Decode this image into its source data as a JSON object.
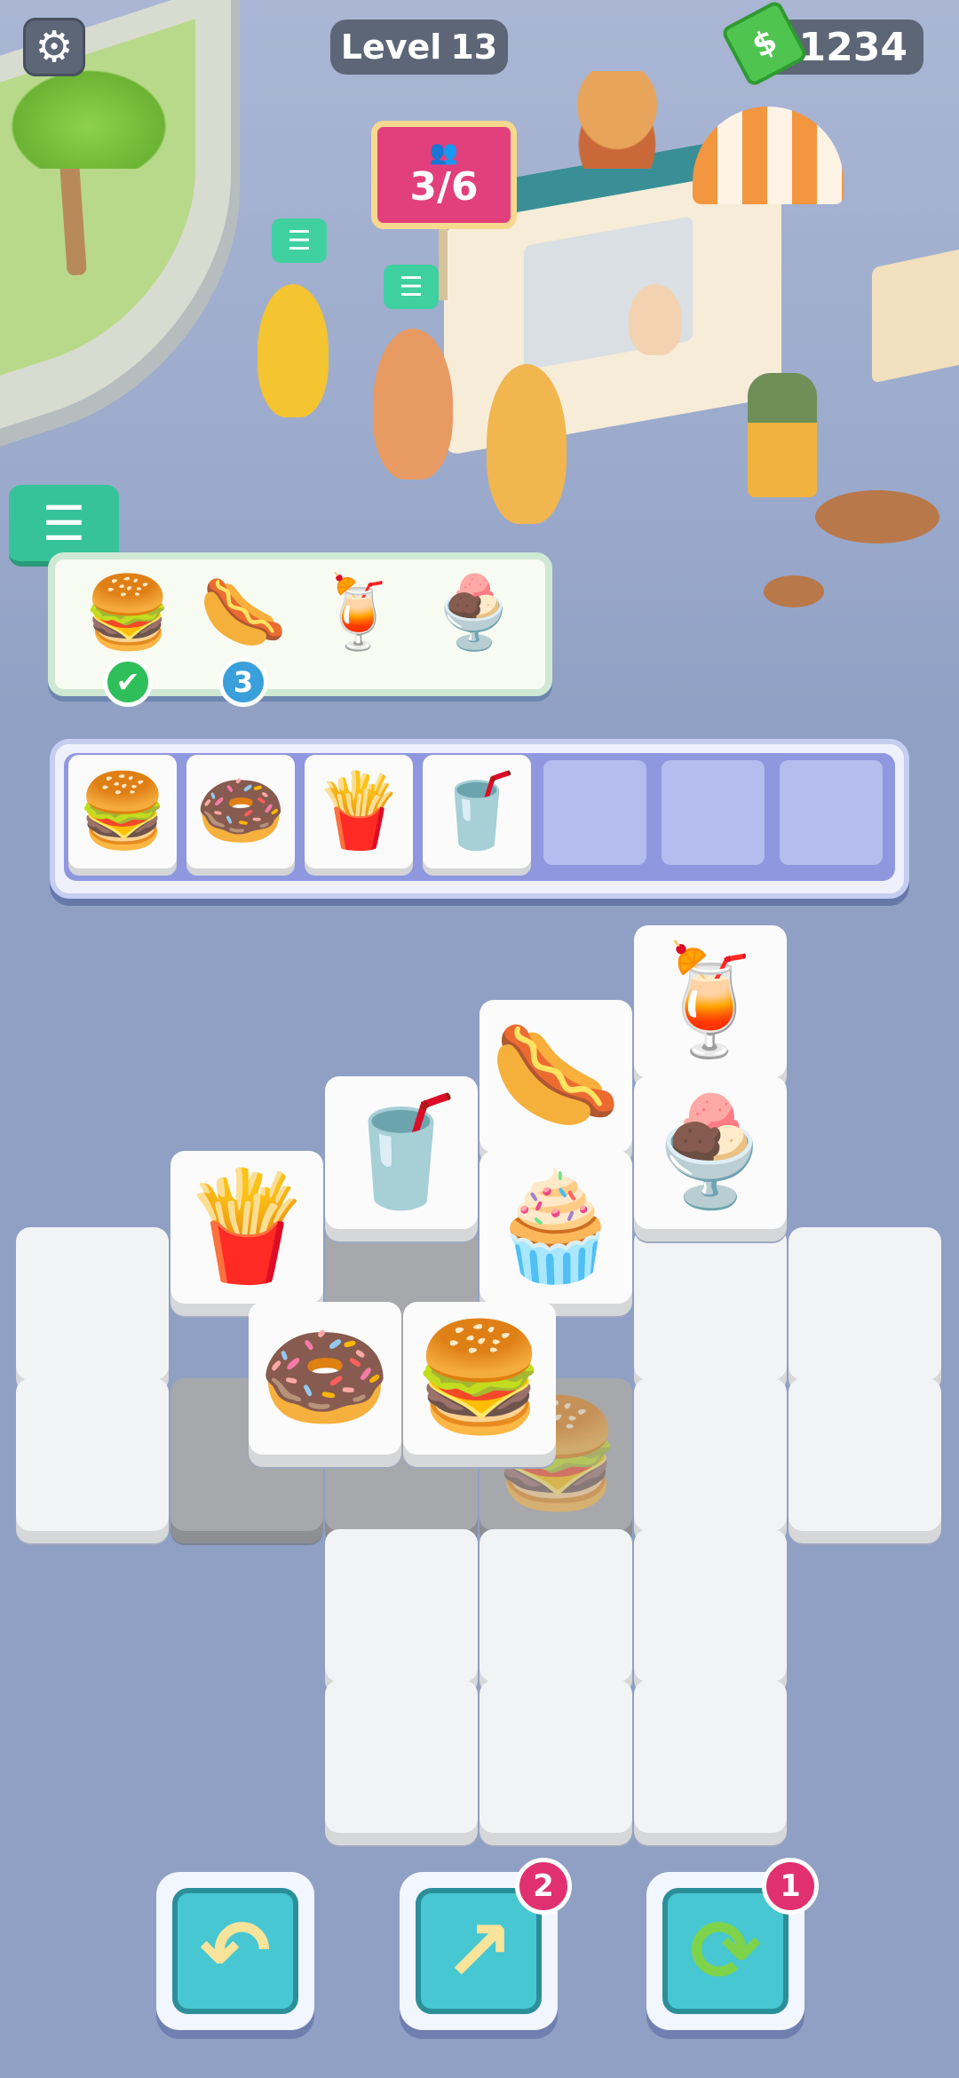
{
  "hud": {
    "settings_icon": "gear-icon",
    "level_label": "Level",
    "level_number": "13",
    "cash_amount": "1234",
    "cash_icon": "cash-icon",
    "cash_symbol": "$"
  },
  "queue_sign": {
    "text": "3/6",
    "icon": "people-icon"
  },
  "orders": {
    "tab_icon": "list-icon",
    "items": [
      {
        "name": "burger",
        "glyph": "🍔",
        "status": "done"
      },
      {
        "name": "hotdog",
        "glyph": "🌭",
        "status": "3"
      },
      {
        "name": "juice",
        "glyph": "🍹",
        "status": ""
      },
      {
        "name": "ice-cream-sundae",
        "glyph": "🍨",
        "status": ""
      }
    ],
    "done_symbol": "✔"
  },
  "tray": {
    "slots": [
      {
        "food": "burger",
        "glyph": "🍔"
      },
      {
        "food": "donut",
        "glyph": "🍩"
      },
      {
        "food": "fries",
        "glyph": "🍟"
      },
      {
        "food": "soda-cup",
        "glyph": "🥤"
      },
      {
        "food": "",
        "glyph": ""
      },
      {
        "food": "",
        "glyph": ""
      },
      {
        "food": "",
        "glyph": ""
      }
    ]
  },
  "board": {
    "tiles": [
      {
        "id": "juice",
        "glyph": "🍹"
      },
      {
        "id": "hotdog",
        "glyph": "🌭"
      },
      {
        "id": "ice-cream",
        "glyph": "🍨"
      },
      {
        "id": "soda",
        "glyph": "🥤"
      },
      {
        "id": "cupcake",
        "glyph": "🧁"
      },
      {
        "id": "fries",
        "glyph": "🍟"
      },
      {
        "id": "donut",
        "glyph": "🍩"
      },
      {
        "id": "burger",
        "glyph": "🍔"
      },
      {
        "id": "burger-shaded",
        "glyph": "🍔"
      }
    ]
  },
  "tools": {
    "undo": {
      "icon": "undo-arrow-icon",
      "glyph": "↶",
      "badge": ""
    },
    "move_out": {
      "icon": "move-out-icon",
      "glyph": "↗",
      "badge": "2"
    },
    "shuffle": {
      "icon": "shuffle-icon",
      "glyph": "⟳",
      "badge": "1"
    }
  },
  "colors": {
    "background": "#8fa0c4",
    "accent_pink": "#e1306f",
    "accent_teal": "#47c7d1",
    "order_green": "#36c39a"
  }
}
